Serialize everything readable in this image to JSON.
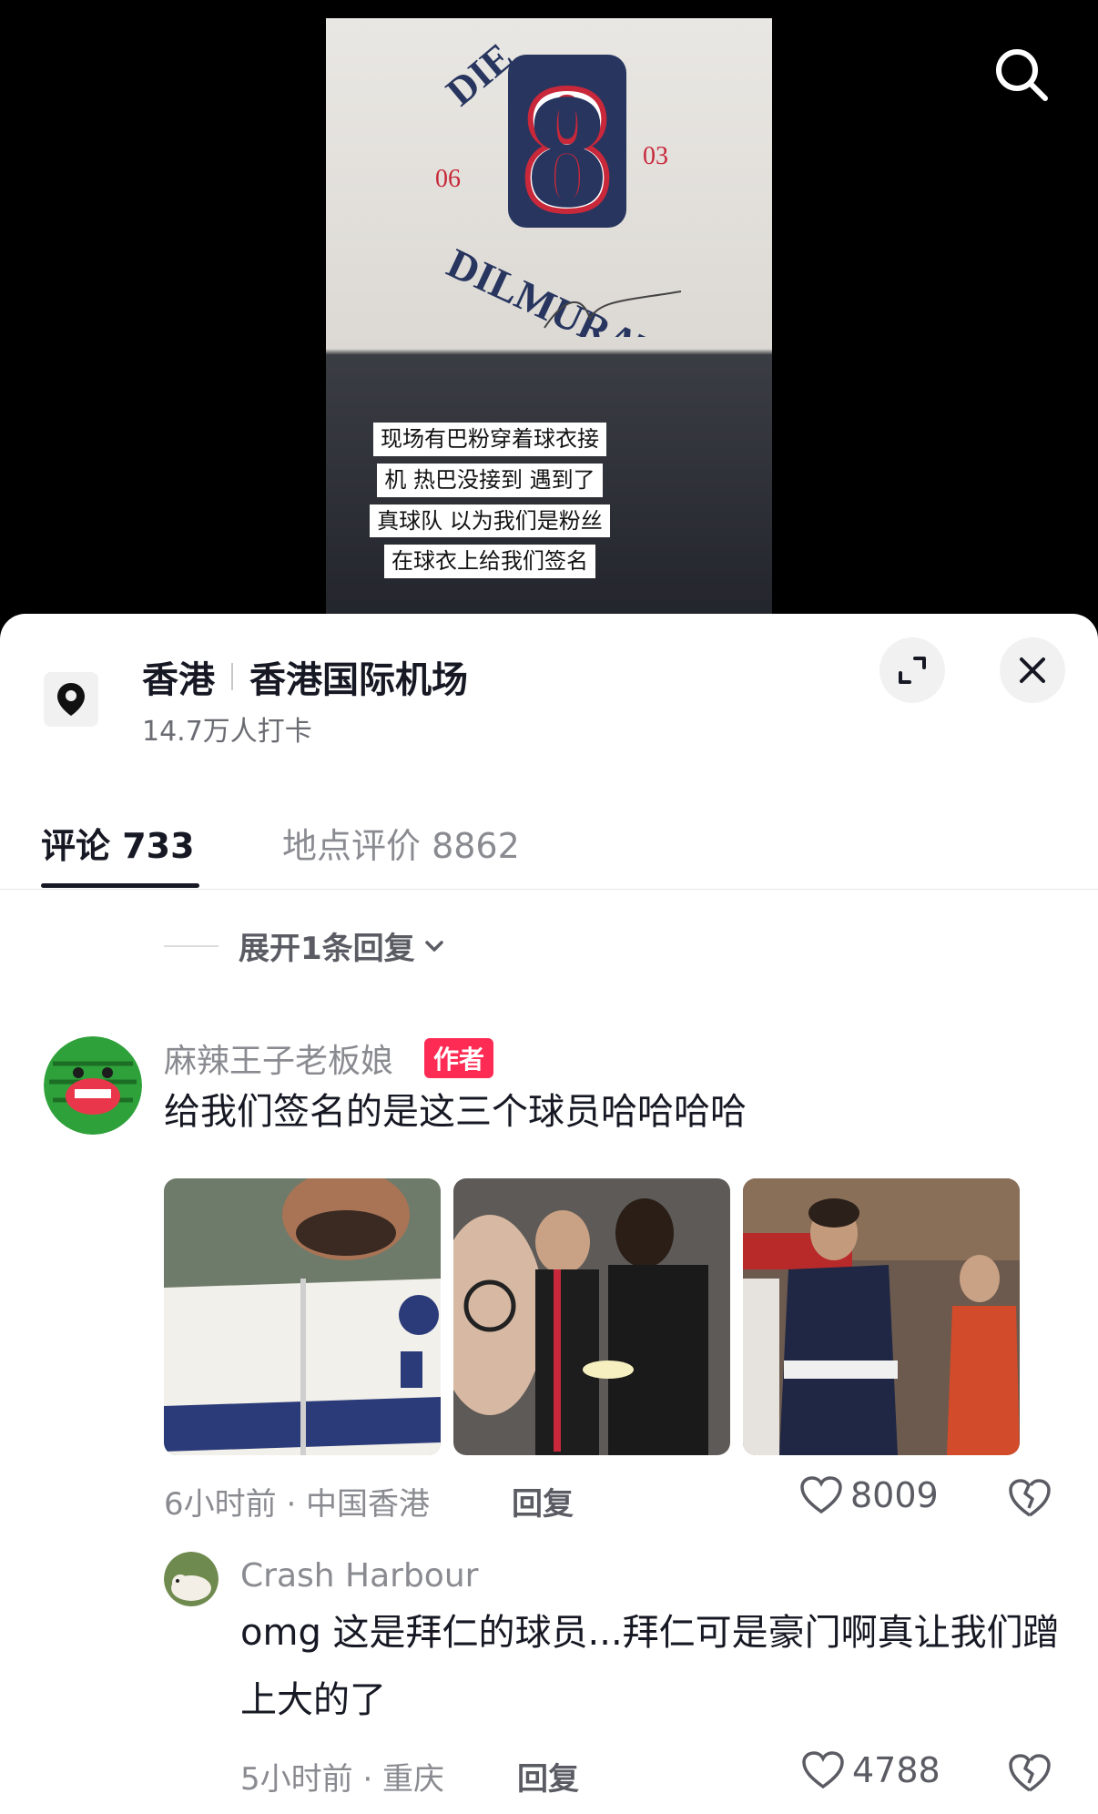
{
  "video": {
    "caption_lines": [
      "现场有巴粉穿着球衣接",
      "机 热巴没接到 遇到了",
      "真球队 以为我们是粉丝",
      "在球衣上给我们签名"
    ],
    "shirt_number": "8",
    "shirt_text_top": "DIE",
    "shirt_text_bottom": "DILMURAT",
    "shirt_left_num": "06",
    "shirt_right_num": "03"
  },
  "location": {
    "city": "香港",
    "place": "香港国际机场",
    "checkins": "14.7万人打卡"
  },
  "tabs": [
    {
      "label": "评论 733",
      "active": true
    },
    {
      "label": "地点评价 8862",
      "active": false
    }
  ],
  "expand_replies": "展开1条回复",
  "comments": [
    {
      "author": "麻辣王子老板娘",
      "badge": "作者",
      "text": "给我们签名的是这三个球员哈哈哈哈",
      "meta": "6小时前 · 中国香港",
      "reply_label": "回复",
      "likes": "8009"
    },
    {
      "author": "Crash Harbour",
      "text": "omg 这是拜仁的球员...拜仁可是豪门啊真让我们蹭上大的了",
      "meta": "5小时前 · 重庆",
      "reply_label": "回复",
      "likes": "4788"
    }
  ],
  "colors": {
    "accent": "#fe2c55",
    "text_primary": "#161823",
    "text_secondary": "#8a8b91"
  },
  "icons": [
    "search-icon",
    "location-pin-icon",
    "expand-icon",
    "close-icon",
    "chevron-down-icon",
    "heart-icon",
    "broken-heart-icon"
  ]
}
